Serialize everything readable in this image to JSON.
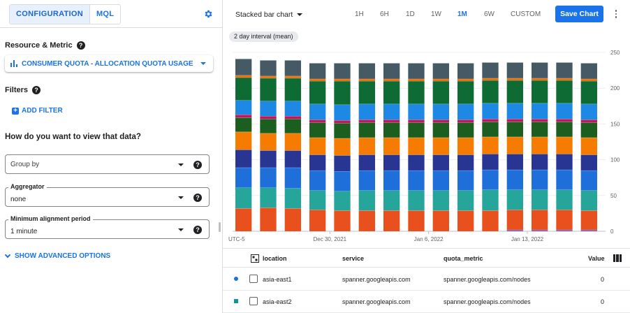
{
  "left": {
    "tabs": [
      {
        "label": "CONFIGURATION"
      },
      {
        "label": "MQL"
      }
    ],
    "resource_metric": {
      "title": "Resource & Metric",
      "chip_label": "CONSUMER QUOTA - ALLOCATION QUOTA USAGE"
    },
    "filters": {
      "title": "Filters",
      "add_label": "ADD FILTER"
    },
    "view_question": "How do you want to view that data?",
    "group_by": {
      "placeholder": "Group by"
    },
    "aggregator": {
      "label": "Aggregator",
      "value": "none"
    },
    "min_alignment": {
      "label": "Minimum alignment period",
      "value": "1 minute"
    },
    "advanced_label": "SHOW ADVANCED OPTIONS"
  },
  "toolbar": {
    "chart_type": "Stacked bar chart",
    "ranges": [
      "1H",
      "6H",
      "1D",
      "1W",
      "1M",
      "6W",
      "CUSTOM"
    ],
    "active_range": "1M",
    "save_label": "Save Chart",
    "interval_chip": "2 day interval (mean)"
  },
  "chart_data": {
    "type": "bar",
    "stacked": true,
    "timezone_label": "UTC-5",
    "x_tick_labels": [
      "Dec 30, 2021",
      "Jan 6, 2022",
      "Jan 13, 2022"
    ],
    "y_ticks": [
      0,
      50,
      100,
      150,
      200,
      250
    ],
    "ylim": [
      0,
      250
    ],
    "y_axis_side": "right",
    "num_bars": 15,
    "colors": [
      "#7e57c2",
      "#e8501d",
      "#26a69a",
      "#1e6fd9",
      "#283593",
      "#f57c00",
      "#1b5e20",
      "#c2185b",
      "#1e88e5",
      "#0e6b33",
      "#ef6c00",
      "#455a64"
    ],
    "totals": [
      241,
      239,
      239,
      235,
      235,
      235,
      235,
      235,
      235,
      235,
      235,
      235,
      235,
      235,
      235
    ],
    "segments_note": "",
    "series": [
      {
        "values": [
          0,
          0,
          0,
          0,
          0,
          0,
          0,
          0,
          0,
          0,
          0,
          2,
          2,
          2,
          2
        ]
      },
      {
        "values": [
          32,
          33,
          32,
          30,
          29,
          29,
          29,
          29,
          29,
          29,
          29,
          28,
          28,
          28,
          27
        ]
      },
      {
        "values": [
          29,
          28,
          28,
          27,
          27,
          28,
          28,
          28,
          28,
          28,
          29,
          28,
          28,
          28,
          28
        ]
      },
      {
        "values": [
          28,
          28,
          29,
          28,
          28,
          28,
          28,
          28,
          28,
          28,
          28,
          28,
          28,
          28,
          28
        ]
      },
      {
        "values": [
          25,
          24,
          24,
          22,
          22,
          22,
          22,
          22,
          22,
          22,
          22,
          22,
          22,
          22,
          22
        ]
      },
      {
        "values": [
          25,
          24,
          24,
          24,
          24,
          24,
          24,
          24,
          24,
          24,
          24,
          24,
          24,
          24,
          24
        ]
      },
      {
        "values": [
          20,
          20,
          20,
          21,
          21,
          21,
          21,
          21,
          21,
          21,
          21,
          21,
          21,
          21,
          21
        ]
      },
      {
        "values": [
          4,
          4,
          4,
          4,
          4,
          4,
          4,
          4,
          4,
          4,
          4,
          4,
          4,
          4,
          4
        ]
      },
      {
        "values": [
          20,
          21,
          21,
          22,
          22,
          22,
          22,
          22,
          22,
          22,
          22,
          22,
          22,
          22,
          22
        ]
      },
      {
        "values": [
          32,
          32,
          32,
          32,
          33,
          32,
          32,
          32,
          32,
          32,
          32,
          32,
          32,
          32,
          32
        ]
      },
      {
        "values": [
          3,
          3,
          3,
          3,
          3,
          3,
          3,
          3,
          3,
          3,
          3,
          3,
          3,
          3,
          3
        ]
      },
      {
        "values": [
          23,
          22,
          22,
          22,
          22,
          22,
          22,
          22,
          22,
          22,
          22,
          22,
          22,
          22,
          22
        ]
      }
    ]
  },
  "table": {
    "headers": {
      "location": "location",
      "service": "service",
      "quota_metric": "quota_metric",
      "value": "Value"
    },
    "rows": [
      {
        "marker_color": "#1e6fd9",
        "marker": "circle",
        "location": "asia-east1",
        "service": "spanner.googleapis.com",
        "quota_metric": "spanner.googleapis.com/nodes",
        "value": "0"
      },
      {
        "marker_color": "#12939a",
        "marker": "square",
        "location": "asia-east2",
        "service": "spanner.googleapis.com",
        "quota_metric": "spanner.googleapis.com/nodes",
        "value": "0"
      }
    ]
  }
}
